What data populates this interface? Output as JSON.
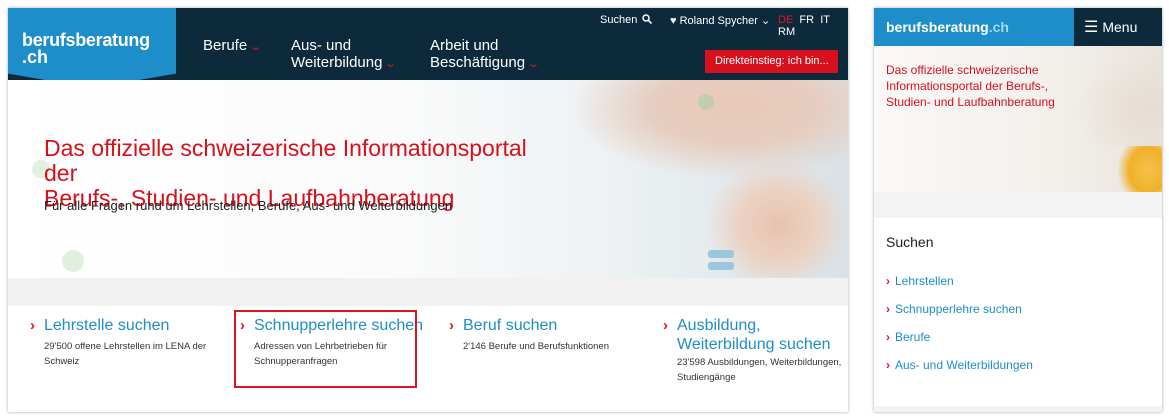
{
  "desktop": {
    "logo": {
      "line1": "berufsberatung",
      "line2": ".ch"
    },
    "nav": [
      {
        "line1": "Berufe",
        "line2": ""
      },
      {
        "line1": "Aus- und",
        "line2": "Weiterbildung"
      },
      {
        "line1": "Arbeit und",
        "line2": "Beschäftigung"
      }
    ],
    "topbar": {
      "search_label": "Suchen",
      "search_icon": "search-icon",
      "user_icon": "heart-icon",
      "user_name": "Roland Spycher",
      "languages": [
        "DE",
        "FR",
        "IT",
        "RM"
      ],
      "active_language": "DE"
    },
    "direct_entry": "Direkteinstieg: ich bin...",
    "hero": {
      "title_line1": "Das offizielle schweizerische Informationsportal der",
      "title_line2": "Berufs-, Studien- und Laufbahnberatung",
      "subtitle": "Für alle Fragen rund um Lehrstellen, Berufe, Aus- und Weiterbildungen"
    },
    "cards": [
      {
        "title": "Lehrstelle suchen",
        "desc_line1": "29'500 offene Lehrstellen im LENA der",
        "desc_line2": "Schweiz"
      },
      {
        "title": "Schnupperlehre suchen",
        "desc_line1": "Adressen von Lehrbetrieben für",
        "desc_line2": "Schnupperanfragen"
      },
      {
        "title": "Beruf suchen",
        "desc_line1": "2'146 Berufe und Berufsfunktionen",
        "desc_line2": ""
      },
      {
        "title_line1": "Ausbildung,",
        "title_line2": "Weiterbildung suchen",
        "desc_line1": "23'598 Ausbildungen, Weiterbildungen,",
        "desc_line2": "Studiengänge"
      }
    ],
    "colors": {
      "header_bg": "#0d2a3c",
      "brand_blue": "#1d8ec9",
      "accent_red": "#d8101c"
    }
  },
  "mobile": {
    "logo": "berufsberatung",
    "logo_suffix": ".ch",
    "menu_label": "Menu",
    "hero_title_line1": "Das offizielle schweizerische",
    "hero_title_line2": "Informationsportal der Berufs-,",
    "hero_title_line3": "Studien- und Laufbahnberatung",
    "search_heading": "Suchen",
    "links": [
      "Lehrstellen",
      "Schnupperlehre suchen",
      "Berufe",
      "Aus- und Weiterbildungen"
    ]
  }
}
